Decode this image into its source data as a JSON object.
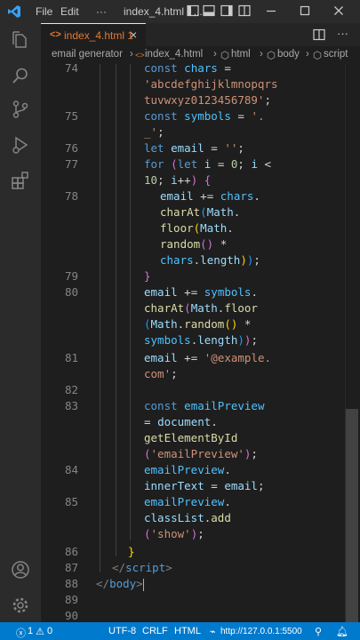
{
  "titlebar": {
    "menu": [
      "File",
      "Edit",
      "···"
    ],
    "window_title": "index_4.html - ..."
  },
  "tab": {
    "label": "index_4.html 1",
    "close": "×"
  },
  "breadcrumb": {
    "folder": "email generator",
    "file": "index_4.html",
    "html": "html",
    "body": "body",
    "script": "script"
  },
  "line_numbers": [
    "74",
    "75",
    "76",
    "77",
    "78",
    "79",
    "80",
    "81",
    "82",
    "83",
    "84",
    "85",
    "86",
    "87",
    "88",
    "89",
    "90"
  ],
  "statusbar": {
    "errors": "1",
    "warnings": "0",
    "encoding": "UTF-8",
    "eol": "CRLF",
    "language": "HTML",
    "server": "http://127.0.0.1:5500"
  },
  "colors": {
    "status_bar": "#007acc",
    "editor_bg": "#1e1e1e",
    "keyword": "#569cd6",
    "variable": "#9cdcfe",
    "string": "#ce9178",
    "tab_label": "#e37933"
  },
  "icons": [
    "vscode-logo-icon",
    "explorer-icon",
    "search-icon",
    "source-control-icon",
    "run-debug-icon",
    "extensions-icon",
    "account-icon",
    "settings-gear-icon",
    "split-editor-icon",
    "more-actions-icon"
  ]
}
